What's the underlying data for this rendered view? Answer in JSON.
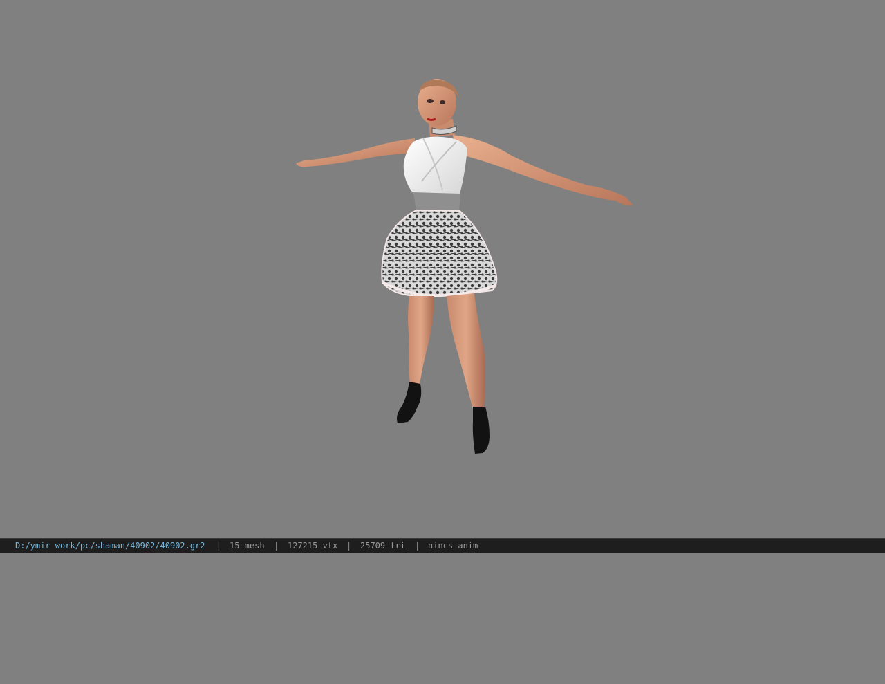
{
  "viewer": {
    "background_color": "#808080",
    "model_icon": "character-model-t-pose"
  },
  "statusbar": {
    "file_path": "D:/ymir work/pc/shaman/40902/40902.gr2",
    "separator": "|",
    "mesh_count": "15 mesh",
    "vertex_count": "127215 vtx",
    "triangle_count": "25709 tri",
    "animation": "nincs anim",
    "path_color": "#78b6d8",
    "text_color": "#9a9a9a"
  }
}
